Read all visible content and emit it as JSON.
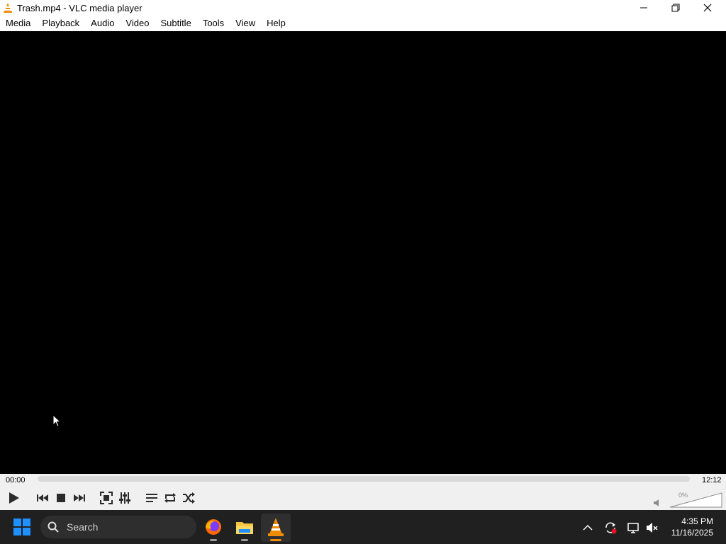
{
  "window": {
    "title": "Trash.mp4 - VLC media player"
  },
  "menu": [
    "Media",
    "Playback",
    "Audio",
    "Video",
    "Subtitle",
    "Tools",
    "View",
    "Help"
  ],
  "player": {
    "elapsed": "00:00",
    "duration": "12:12",
    "progress": 0,
    "volume_label": "0%",
    "volume": 0
  },
  "taskbar": {
    "search_placeholder": "Search",
    "clock_time": "4:35 PM",
    "clock_date": "11/16/2025"
  },
  "colors": {
    "vlc_orange": "#f08a00",
    "taskbar_bg": "#202020",
    "controls_bg": "#f0f0f0",
    "windows_blue": "#1e90ff"
  }
}
